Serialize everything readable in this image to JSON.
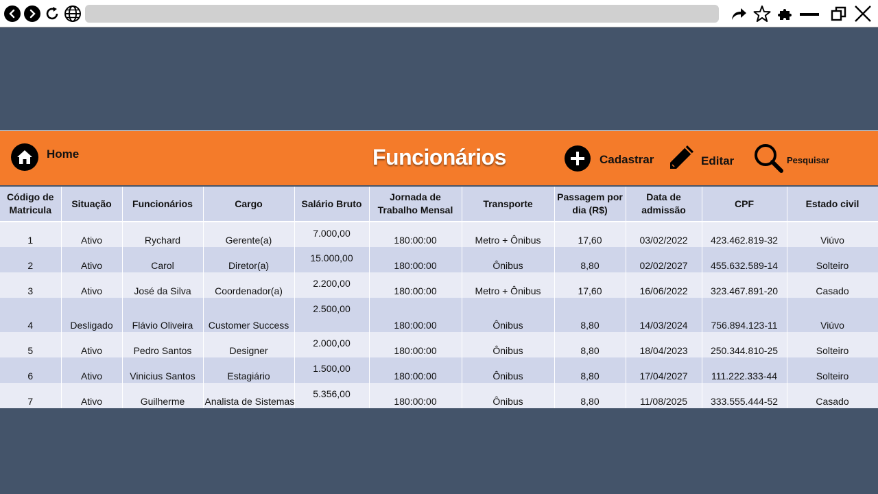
{
  "browser": {
    "back_icon": "arrow-left-icon",
    "forward_icon": "arrow-right-icon",
    "reload_icon": "reload-icon",
    "globe_icon": "globe-icon",
    "share_icon": "share-arrow-icon",
    "bookmark_icon": "star-icon",
    "extensions_icon": "puzzle-icon",
    "minimize_icon": "minimize-icon",
    "restore_icon": "restore-icon",
    "close_icon": "close-icon"
  },
  "header": {
    "home_label": "Home",
    "title": "Funcionários",
    "add_label": "Cadastrar",
    "edit_label": "Editar",
    "search_label": "Pesquisar",
    "accent_color": "#f47b2a"
  },
  "table": {
    "columns": [
      "Código de Matricula",
      "Situação",
      "Funcionários",
      "Cargo",
      "Salário Bruto",
      "Jornada de Trabalho Mensal",
      "Transporte",
      "Passagem por dia (R$)",
      "Data de admissão",
      "CPF",
      "Estado civil"
    ],
    "rows": [
      [
        "1",
        "Ativo",
        "Rychard",
        "Gerente(a)",
        "7.000,00",
        "180:00:00",
        "Metro + Ônibus",
        "17,60",
        "03/02/2022",
        "423.462.819-32",
        "Viúvo"
      ],
      [
        "2",
        "Ativo",
        "Carol",
        "Diretor(a)",
        "15.000,00",
        "180:00:00",
        "Ônibus",
        "8,80",
        "02/02/2027",
        "455.632.589-14",
        "Solteiro"
      ],
      [
        "3",
        "Ativo",
        "José da Silva",
        "Coordenador(a)",
        "2.200,00",
        "180:00:00",
        "Metro + Ônibus",
        "17,60",
        "16/06/2022",
        "323.467.891-20",
        "Casado"
      ],
      [
        "4",
        "Desligado",
        "Flávio Oliveira",
        "Customer Success",
        "2.500,00",
        "180:00:00",
        "Ônibus",
        "8,80",
        "14/03/2024",
        "756.894.123-11",
        "Viúvo"
      ],
      [
        "5",
        "Ativo",
        "Pedro  Santos",
        "Designer",
        "2.000,00",
        "180:00:00",
        "Ônibus",
        "8,80",
        "18/04/2023",
        "250.344.810-25",
        "Solteiro"
      ],
      [
        "6",
        "Ativo",
        "Vinicius Santos",
        "Estagiário",
        "1.500,00",
        "180:00:00",
        "Ônibus",
        "8,80",
        "17/04/2027",
        "111.222.333-44",
        "Solteiro"
      ],
      [
        "7",
        "Ativo",
        "Guilherme",
        "Analista de Sistemas",
        "5.356,00",
        "180:00:00",
        "Ônibus",
        "8,80",
        "11/08/2025",
        "333.555.444-52",
        "Casado"
      ]
    ]
  }
}
